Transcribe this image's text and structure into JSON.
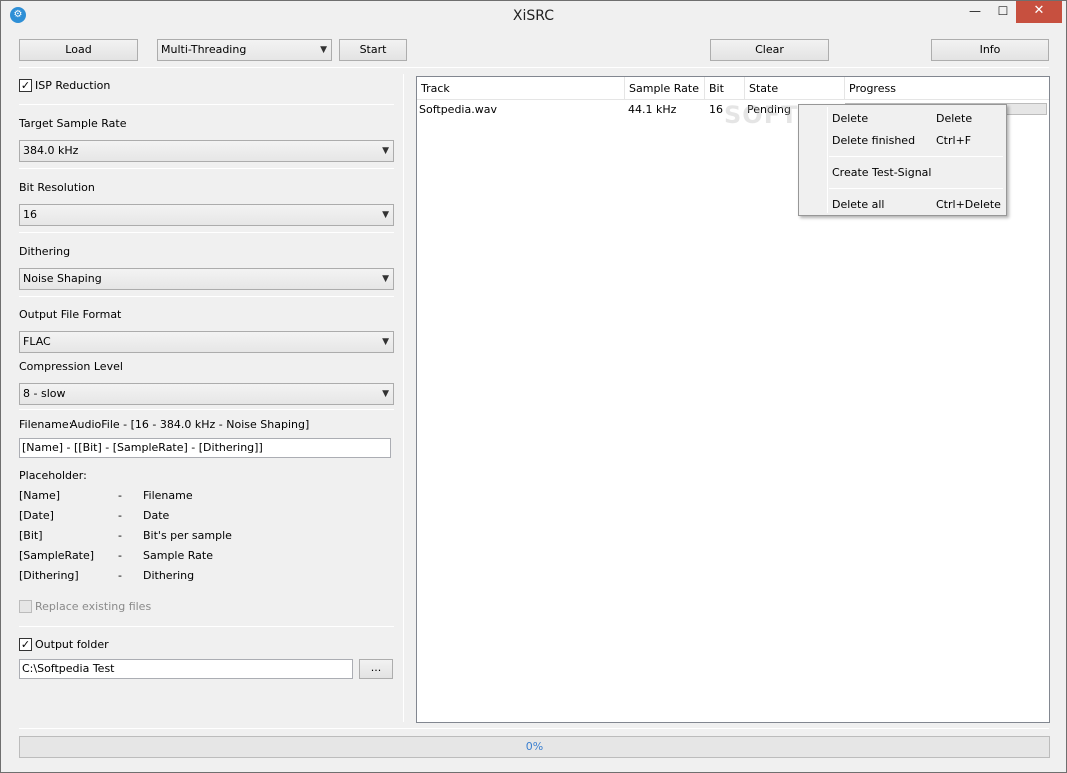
{
  "window": {
    "title": "XiSRC",
    "icon": "app-icon",
    "min_glyph": "—",
    "max_glyph": "☐",
    "close_glyph": "✕"
  },
  "toolbar": {
    "load_label": "Load",
    "threading_value": "Multi-Threading",
    "start_label": "Start",
    "clear_label": "Clear",
    "info_label": "Info"
  },
  "settings": {
    "isp_reduction_label": "ISP Reduction",
    "isp_reduction_checked": true,
    "target_rate_label": "Target Sample Rate",
    "target_rate_value": "384.0 kHz",
    "bit_res_label": "Bit Resolution",
    "bit_res_value": "16",
    "dithering_label": "Dithering",
    "dithering_value": "Noise Shaping",
    "format_label": "Output File Format",
    "format_value": "FLAC",
    "compression_label": "Compression Level",
    "compression_value": "8 - slow",
    "filename_label": "Filename:",
    "filename_preview": "AudioFile - [16 - 384.0 kHz - Noise Shaping]",
    "filename_pattern": "[Name] - [[Bit] - [SampleRate] - [Dithering]]",
    "placeholder_label": "Placeholder:",
    "placeholders": [
      {
        "token": "[Name]",
        "dash": "-",
        "desc": "Filename"
      },
      {
        "token": "[Date]",
        "dash": "-",
        "desc": "Date"
      },
      {
        "token": "[Bit]",
        "dash": "-",
        "desc": "Bit's per sample"
      },
      {
        "token": "[SampleRate]",
        "dash": "-",
        "desc": "Sample Rate"
      },
      {
        "token": "[Dithering]",
        "dash": "-",
        "desc": "Dithering"
      }
    ],
    "replace_label": "Replace existing files",
    "replace_checked": false,
    "output_folder_label": "Output folder",
    "output_folder_checked": true,
    "output_folder_value": "C:\\Softpedia Test",
    "browse_label": "..."
  },
  "tracklist": {
    "columns": [
      "Track",
      "Sample Rate",
      "Bit",
      "State",
      "Progress"
    ],
    "rows": [
      {
        "track": "Softpedia.wav",
        "rate": "44.1 kHz",
        "bit": "16",
        "state": "Pending"
      }
    ]
  },
  "context_menu": {
    "items": [
      {
        "label": "Delete",
        "shortcut": "Delete"
      },
      {
        "label": "Delete finished",
        "shortcut": "Ctrl+F"
      },
      {
        "label": "Create Test-Signal",
        "shortcut": ""
      },
      {
        "label": "Delete all",
        "shortcut": "Ctrl+Delete"
      }
    ]
  },
  "watermark": "SOFTPEDIA",
  "status": {
    "progress_text": "0%",
    "progress_value": 0
  }
}
